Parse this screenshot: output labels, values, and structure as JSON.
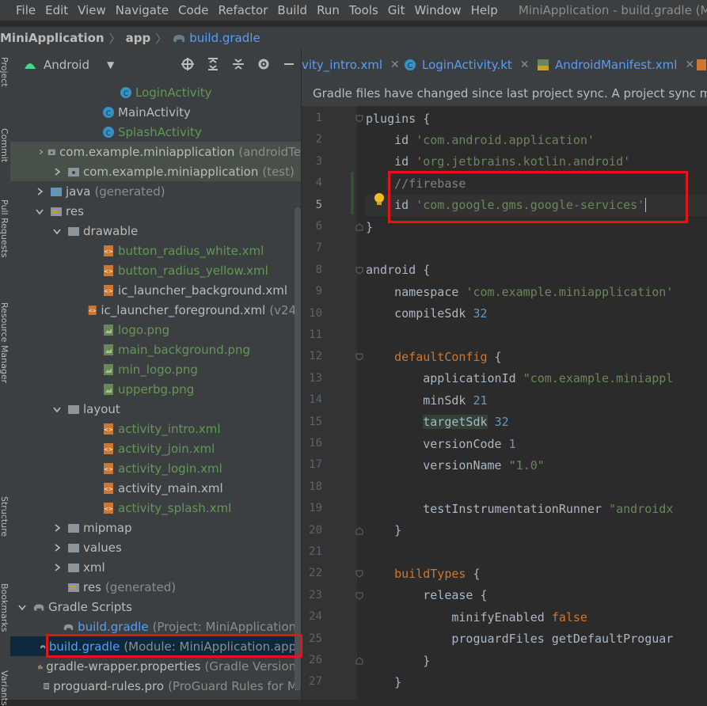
{
  "menubar": {
    "items": [
      "File",
      "Edit",
      "View",
      "Navigate",
      "Code",
      "Refactor",
      "Build",
      "Run",
      "Tools",
      "Git",
      "Window",
      "Help"
    ],
    "window_title": "MiniApplication - build.gradle (M"
  },
  "navbar": {
    "project": "MiniApplication",
    "module": "app",
    "file": "build.gradle"
  },
  "left_strip": {
    "tabs": [
      "Project",
      "Commit",
      "Pull Requests",
      "Resource Manager",
      "Structure",
      "Bookmarks",
      "Variants"
    ]
  },
  "project_panel": {
    "view_mode": "Android"
  },
  "tree": [
    {
      "label": "LoginActivity",
      "hint": "",
      "color": "green"
    },
    {
      "label": "MainActivity",
      "hint": "",
      "color": "default"
    },
    {
      "label": "SplashActivity",
      "hint": "",
      "color": "green"
    },
    {
      "label": "com.example.miniapplication",
      "hint": "(androidTe",
      "color": "default"
    },
    {
      "label": "com.example.miniapplication",
      "hint": "(test)",
      "color": "default"
    },
    {
      "label": "java",
      "hint": "(generated)",
      "color": "default"
    },
    {
      "label": "res",
      "hint": "",
      "color": "default"
    },
    {
      "label": "drawable",
      "hint": "",
      "color": "default"
    },
    {
      "label": "button_radius_white.xml",
      "hint": "",
      "color": "green"
    },
    {
      "label": "button_radius_yellow.xml",
      "hint": "",
      "color": "green"
    },
    {
      "label": "ic_launcher_background.xml",
      "hint": "",
      "color": "default"
    },
    {
      "label": "ic_launcher_foreground.xml",
      "hint": "(v24)",
      "color": "default"
    },
    {
      "label": "logo.png",
      "hint": "",
      "color": "green"
    },
    {
      "label": "main_background.png",
      "hint": "",
      "color": "green"
    },
    {
      "label": "min_logo.png",
      "hint": "",
      "color": "green"
    },
    {
      "label": "upperbg.png",
      "hint": "",
      "color": "green"
    },
    {
      "label": "layout",
      "hint": "",
      "color": "default"
    },
    {
      "label": "activity_intro.xml",
      "hint": "",
      "color": "green"
    },
    {
      "label": "activity_join.xml",
      "hint": "",
      "color": "green"
    },
    {
      "label": "activity_login.xml",
      "hint": "",
      "color": "green"
    },
    {
      "label": "activity_main.xml",
      "hint": "",
      "color": "default"
    },
    {
      "label": "activity_splash.xml",
      "hint": "",
      "color": "green"
    },
    {
      "label": "mipmap",
      "hint": "",
      "color": "default"
    },
    {
      "label": "values",
      "hint": "",
      "color": "default"
    },
    {
      "label": "xml",
      "hint": "",
      "color": "default"
    },
    {
      "label": "res",
      "hint": "(generated)",
      "color": "default"
    },
    {
      "label": "Gradle Scripts",
      "hint": "",
      "color": "default"
    },
    {
      "label": "build.gradle",
      "hint": "(Project: MiniApplication)",
      "color": "blue"
    },
    {
      "label": "build.gradle",
      "hint": "(Module: MiniApplication.app)",
      "color": "blue"
    },
    {
      "label": "gradle-wrapper.properties",
      "hint": "(Gradle Version)",
      "color": "default"
    },
    {
      "label": "proguard-rules.pro",
      "hint": "(ProGuard Rules for Mi",
      "color": "default"
    }
  ],
  "editor_tabs": [
    {
      "label": "vity_intro.xml",
      "icon": "xml-file-icon"
    },
    {
      "label": "LoginActivity.kt",
      "icon": "kotlin-class-icon"
    },
    {
      "label": "AndroidManifest.xml",
      "icon": "manifest-file-icon"
    }
  ],
  "banner": {
    "text": "Gradle files have changed since last project sync. A project sync may be n"
  },
  "code_lines": [
    {
      "n": "1",
      "t": [
        [
          "fn",
          "plugins {"
        ]
      ]
    },
    {
      "n": "2",
      "t": [
        [
          "fn",
          "    id "
        ],
        [
          "str",
          "'com.android.application'"
        ]
      ]
    },
    {
      "n": "3",
      "t": [
        [
          "fn",
          "    id "
        ],
        [
          "str",
          "'org.jetbrains.kotlin.android'"
        ]
      ]
    },
    {
      "n": "4",
      "t": [
        [
          "cmt",
          "    //firebase"
        ]
      ]
    },
    {
      "n": "5",
      "t": [
        [
          "fn",
          "    id "
        ],
        [
          "str",
          "'com.google.gms.google-services'"
        ]
      ]
    },
    {
      "n": "6",
      "t": [
        [
          "fn",
          "}"
        ]
      ]
    },
    {
      "n": "7",
      "t": []
    },
    {
      "n": "8",
      "t": [
        [
          "fn",
          "android {"
        ]
      ]
    },
    {
      "n": "9",
      "t": [
        [
          "fn",
          "    namespace "
        ],
        [
          "str",
          "'com.example.miniapplication'"
        ]
      ]
    },
    {
      "n": "10",
      "t": [
        [
          "fn",
          "    compileSdk "
        ],
        [
          "num",
          "32"
        ]
      ]
    },
    {
      "n": "11",
      "t": []
    },
    {
      "n": "12",
      "t": [
        [
          "kw",
          "    defaultConfig"
        ],
        [
          "fn",
          " {"
        ]
      ]
    },
    {
      "n": "13",
      "t": [
        [
          "fn",
          "        applicationId "
        ],
        [
          "str",
          "\"com.example.miniappl"
        ]
      ]
    },
    {
      "n": "14",
      "t": [
        [
          "fn",
          "        minSdk "
        ],
        [
          "num",
          "21"
        ]
      ]
    },
    {
      "n": "15",
      "t": [
        [
          "fn",
          "        "
        ],
        [
          "tsdk",
          "targetSdk"
        ],
        [
          "fn",
          " "
        ],
        [
          "num",
          "32"
        ]
      ]
    },
    {
      "n": "16",
      "t": [
        [
          "fn",
          "        versionCode "
        ],
        [
          "num",
          "1"
        ]
      ]
    },
    {
      "n": "17",
      "t": [
        [
          "fn",
          "        versionName "
        ],
        [
          "str",
          "\"1.0\""
        ]
      ]
    },
    {
      "n": "18",
      "t": []
    },
    {
      "n": "19",
      "t": [
        [
          "fn",
          "        testInstrumentationRunner "
        ],
        [
          "str",
          "\"androidx"
        ]
      ]
    },
    {
      "n": "20",
      "t": [
        [
          "fn",
          "    }"
        ]
      ]
    },
    {
      "n": "21",
      "t": []
    },
    {
      "n": "22",
      "t": [
        [
          "kw",
          "    buildTypes"
        ],
        [
          "fn",
          " {"
        ]
      ]
    },
    {
      "n": "23",
      "t": [
        [
          "fn",
          "        release {"
        ]
      ]
    },
    {
      "n": "24",
      "t": [
        [
          "fn",
          "            minifyEnabled "
        ],
        [
          "kw",
          "false"
        ]
      ]
    },
    {
      "n": "25",
      "t": [
        [
          "fn",
          "            proguardFiles getDefaultProguar"
        ]
      ]
    },
    {
      "n": "26",
      "t": [
        [
          "fn",
          "        }"
        ]
      ]
    },
    {
      "n": "27",
      "t": [
        [
          "fn",
          "    }"
        ]
      ]
    }
  ]
}
